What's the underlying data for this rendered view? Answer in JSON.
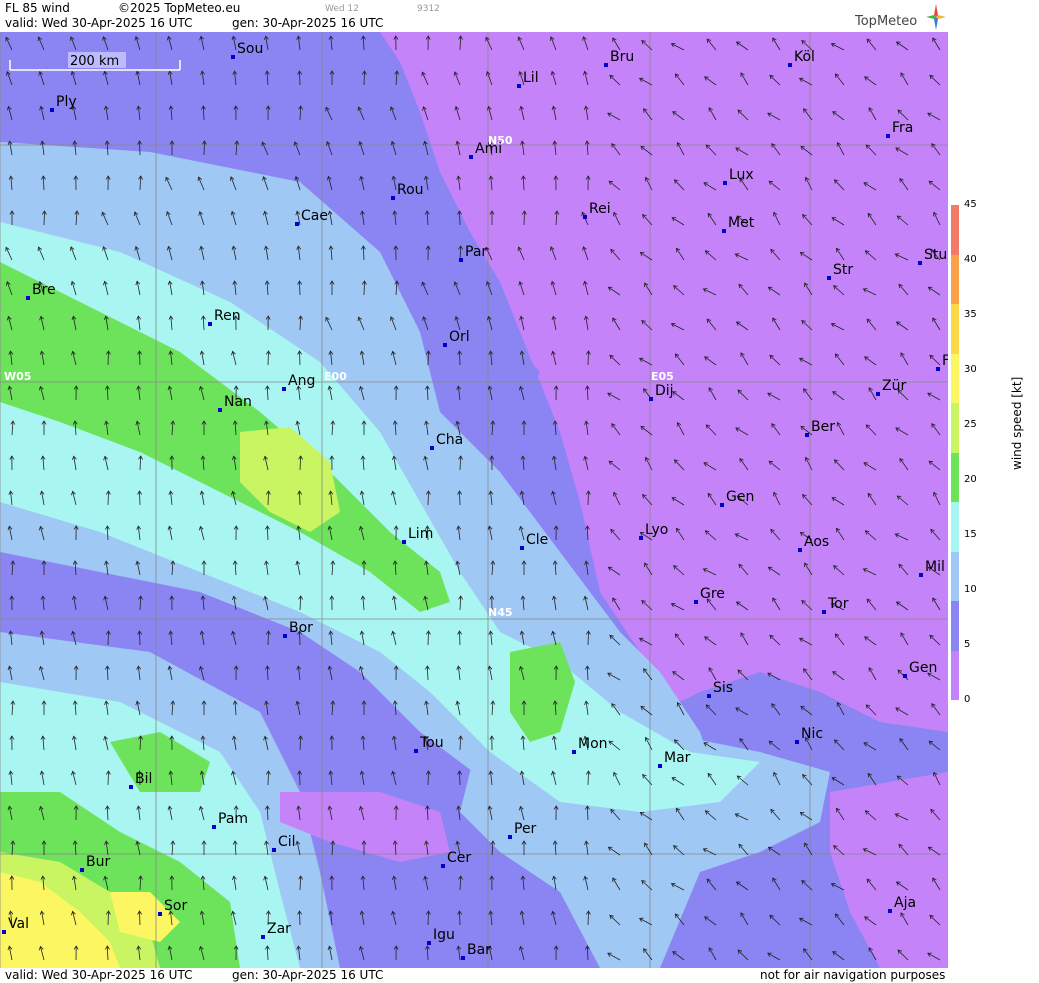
{
  "header": {
    "product": "FL 85 wind",
    "copyright": "©2025 TopMeteo.eu",
    "valid": "valid:  Wed  30-Apr-2025  16 UTC",
    "gen": "gen:  30-Apr-2025  16 UTC",
    "day_code": "Wed 12",
    "id_code": "9312",
    "logo": "TopMeteo"
  },
  "footer": {
    "valid": "valid:  Wed  30-Apr-2025  16 UTC",
    "gen": "gen:  30-Apr-2025  16 UTC",
    "disclaimer": "not for air navigation purposes"
  },
  "scale_bar": {
    "label": "200 km"
  },
  "legend": {
    "title": "wind  speed  [kt]",
    "ticks": [
      "45",
      "40",
      "35",
      "30",
      "25",
      "20",
      "15",
      "10",
      "5",
      "0"
    ],
    "colors": [
      "#f27a67",
      "#f9a24a",
      "#fdd84a",
      "#fbf661",
      "#c9f562",
      "#6de35c",
      "#a9f5f1",
      "#9fc8f5",
      "#8a85f2",
      "#c483f8"
    ]
  },
  "grid_labels": [
    "N50",
    "N45",
    "W05",
    "E00",
    "E05"
  ],
  "cities": [
    {
      "name": "Sou"
    },
    {
      "name": "Ply"
    },
    {
      "name": "Lil"
    },
    {
      "name": "Bru"
    },
    {
      "name": "Köl"
    },
    {
      "name": "Ami"
    },
    {
      "name": "Fra"
    },
    {
      "name": "Rou"
    },
    {
      "name": "Lux"
    },
    {
      "name": "Cae"
    },
    {
      "name": "Rei"
    },
    {
      "name": "Met"
    },
    {
      "name": "Par"
    },
    {
      "name": "Stu"
    },
    {
      "name": "Str"
    },
    {
      "name": "Bre"
    },
    {
      "name": "Ren"
    },
    {
      "name": "Orl"
    },
    {
      "name": "Ang"
    },
    {
      "name": "Dij"
    },
    {
      "name": "Zür"
    },
    {
      "name": "Nan"
    },
    {
      "name": "Ber"
    },
    {
      "name": "Cha"
    },
    {
      "name": "Gen"
    },
    {
      "name": "Lim"
    },
    {
      "name": "Cle"
    },
    {
      "name": "Lyo"
    },
    {
      "name": "Aos"
    },
    {
      "name": "Mil"
    },
    {
      "name": "Gre"
    },
    {
      "name": "Tor"
    },
    {
      "name": "Bor"
    },
    {
      "name": "Gen"
    },
    {
      "name": "Sis"
    },
    {
      "name": "Tou"
    },
    {
      "name": "Mon"
    },
    {
      "name": "Nic"
    },
    {
      "name": "Mar"
    },
    {
      "name": "Bil"
    },
    {
      "name": "Pam"
    },
    {
      "name": "Cil"
    },
    {
      "name": "Per"
    },
    {
      "name": "Bur"
    },
    {
      "name": "Cer"
    },
    {
      "name": "Sor"
    },
    {
      "name": "Val"
    },
    {
      "name": "Zar"
    },
    {
      "name": "Igu"
    },
    {
      "name": "Aja"
    },
    {
      "name": "Bar"
    },
    {
      "name": "F"
    }
  ],
  "icons": {
    "compass": "compass-star-icon"
  }
}
